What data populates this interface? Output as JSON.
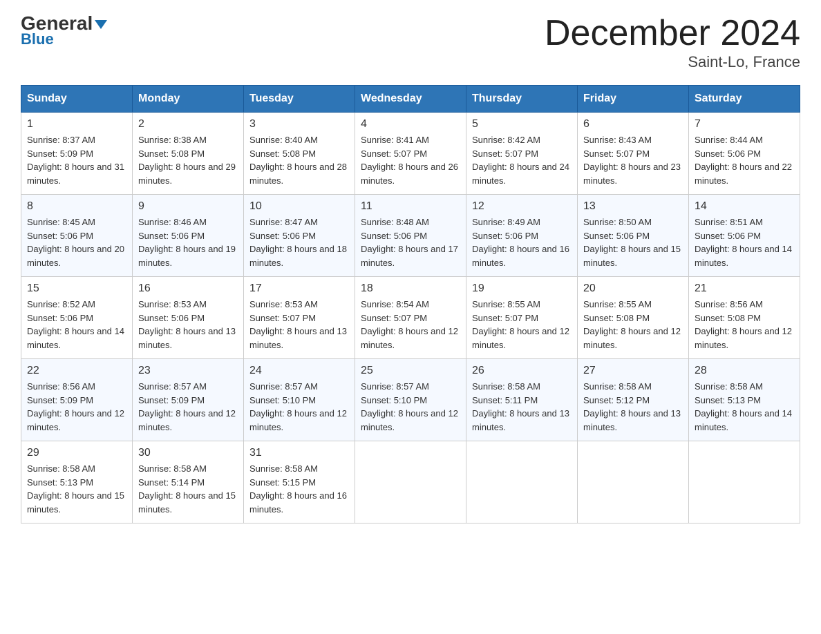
{
  "header": {
    "logo_general": "General",
    "logo_blue": "Blue",
    "month_title": "December 2024",
    "location": "Saint-Lo, France"
  },
  "columns": [
    "Sunday",
    "Monday",
    "Tuesday",
    "Wednesday",
    "Thursday",
    "Friday",
    "Saturday"
  ],
  "weeks": [
    [
      {
        "day": "1",
        "sunrise": "8:37 AM",
        "sunset": "5:09 PM",
        "daylight": "8 hours and 31 minutes."
      },
      {
        "day": "2",
        "sunrise": "8:38 AM",
        "sunset": "5:08 PM",
        "daylight": "8 hours and 29 minutes."
      },
      {
        "day": "3",
        "sunrise": "8:40 AM",
        "sunset": "5:08 PM",
        "daylight": "8 hours and 28 minutes."
      },
      {
        "day": "4",
        "sunrise": "8:41 AM",
        "sunset": "5:07 PM",
        "daylight": "8 hours and 26 minutes."
      },
      {
        "day": "5",
        "sunrise": "8:42 AM",
        "sunset": "5:07 PM",
        "daylight": "8 hours and 24 minutes."
      },
      {
        "day": "6",
        "sunrise": "8:43 AM",
        "sunset": "5:07 PM",
        "daylight": "8 hours and 23 minutes."
      },
      {
        "day": "7",
        "sunrise": "8:44 AM",
        "sunset": "5:06 PM",
        "daylight": "8 hours and 22 minutes."
      }
    ],
    [
      {
        "day": "8",
        "sunrise": "8:45 AM",
        "sunset": "5:06 PM",
        "daylight": "8 hours and 20 minutes."
      },
      {
        "day": "9",
        "sunrise": "8:46 AM",
        "sunset": "5:06 PM",
        "daylight": "8 hours and 19 minutes."
      },
      {
        "day": "10",
        "sunrise": "8:47 AM",
        "sunset": "5:06 PM",
        "daylight": "8 hours and 18 minutes."
      },
      {
        "day": "11",
        "sunrise": "8:48 AM",
        "sunset": "5:06 PM",
        "daylight": "8 hours and 17 minutes."
      },
      {
        "day": "12",
        "sunrise": "8:49 AM",
        "sunset": "5:06 PM",
        "daylight": "8 hours and 16 minutes."
      },
      {
        "day": "13",
        "sunrise": "8:50 AM",
        "sunset": "5:06 PM",
        "daylight": "8 hours and 15 minutes."
      },
      {
        "day": "14",
        "sunrise": "8:51 AM",
        "sunset": "5:06 PM",
        "daylight": "8 hours and 14 minutes."
      }
    ],
    [
      {
        "day": "15",
        "sunrise": "8:52 AM",
        "sunset": "5:06 PM",
        "daylight": "8 hours and 14 minutes."
      },
      {
        "day": "16",
        "sunrise": "8:53 AM",
        "sunset": "5:06 PM",
        "daylight": "8 hours and 13 minutes."
      },
      {
        "day": "17",
        "sunrise": "8:53 AM",
        "sunset": "5:07 PM",
        "daylight": "8 hours and 13 minutes."
      },
      {
        "day": "18",
        "sunrise": "8:54 AM",
        "sunset": "5:07 PM",
        "daylight": "8 hours and 12 minutes."
      },
      {
        "day": "19",
        "sunrise": "8:55 AM",
        "sunset": "5:07 PM",
        "daylight": "8 hours and 12 minutes."
      },
      {
        "day": "20",
        "sunrise": "8:55 AM",
        "sunset": "5:08 PM",
        "daylight": "8 hours and 12 minutes."
      },
      {
        "day": "21",
        "sunrise": "8:56 AM",
        "sunset": "5:08 PM",
        "daylight": "8 hours and 12 minutes."
      }
    ],
    [
      {
        "day": "22",
        "sunrise": "8:56 AM",
        "sunset": "5:09 PM",
        "daylight": "8 hours and 12 minutes."
      },
      {
        "day": "23",
        "sunrise": "8:57 AM",
        "sunset": "5:09 PM",
        "daylight": "8 hours and 12 minutes."
      },
      {
        "day": "24",
        "sunrise": "8:57 AM",
        "sunset": "5:10 PM",
        "daylight": "8 hours and 12 minutes."
      },
      {
        "day": "25",
        "sunrise": "8:57 AM",
        "sunset": "5:10 PM",
        "daylight": "8 hours and 12 minutes."
      },
      {
        "day": "26",
        "sunrise": "8:58 AM",
        "sunset": "5:11 PM",
        "daylight": "8 hours and 13 minutes."
      },
      {
        "day": "27",
        "sunrise": "8:58 AM",
        "sunset": "5:12 PM",
        "daylight": "8 hours and 13 minutes."
      },
      {
        "day": "28",
        "sunrise": "8:58 AM",
        "sunset": "5:13 PM",
        "daylight": "8 hours and 14 minutes."
      }
    ],
    [
      {
        "day": "29",
        "sunrise": "8:58 AM",
        "sunset": "5:13 PM",
        "daylight": "8 hours and 15 minutes."
      },
      {
        "day": "30",
        "sunrise": "8:58 AM",
        "sunset": "5:14 PM",
        "daylight": "8 hours and 15 minutes."
      },
      {
        "day": "31",
        "sunrise": "8:58 AM",
        "sunset": "5:15 PM",
        "daylight": "8 hours and 16 minutes."
      },
      null,
      null,
      null,
      null
    ]
  ]
}
